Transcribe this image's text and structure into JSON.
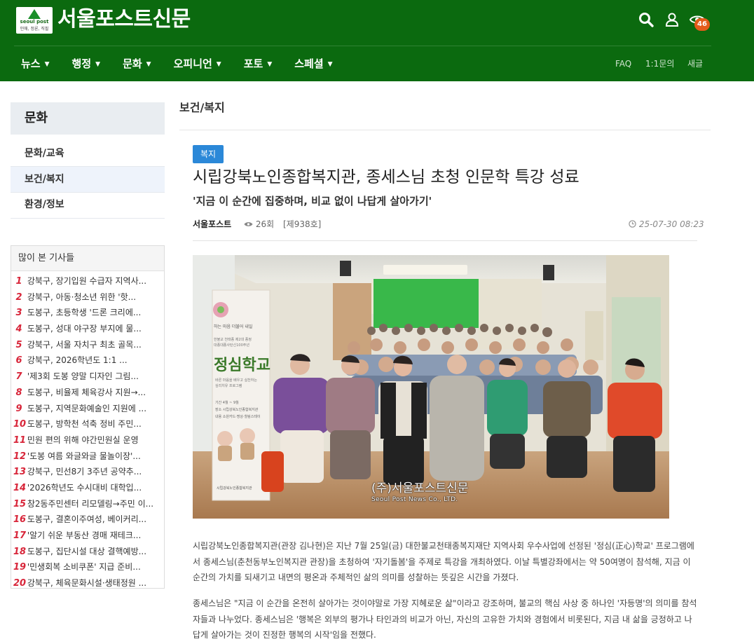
{
  "header": {
    "logo_line1": "seoul post",
    "logo_line2": "인애, 정론, 직필",
    "site_title": "서울포스트신문",
    "notification_count": "46",
    "nav": [
      "뉴스",
      "행정",
      "문화",
      "오피니언",
      "포토",
      "스페셜"
    ],
    "util_links": [
      "FAQ",
      "1:1문의",
      "새글"
    ]
  },
  "sidebar": {
    "heading": "문화",
    "items": [
      "문화/교육",
      "보건/복지",
      "환경/정보"
    ],
    "popular_heading": "많이 본 기사들",
    "popular": [
      {
        "num": "1",
        "title": "강북구, 장기입원 수급자 지역사..."
      },
      {
        "num": "2",
        "title": "강북구, 아동·청소년 위한 '핫..."
      },
      {
        "num": "3",
        "title": "도봉구, 초등학생 '드론 크리에..."
      },
      {
        "num": "4",
        "title": "도봉구, 성대 야구장 부지에 물..."
      },
      {
        "num": "5",
        "title": "강북구, 서울 자치구 최초 골목..."
      },
      {
        "num": "6",
        "title": "강북구, 2026학년도 1:1 ..."
      },
      {
        "num": "7",
        "title": "'제3회 도봉 양말 디자인 그림..."
      },
      {
        "num": "8",
        "title": "도봉구, 비율제 체육강사 지원→..."
      },
      {
        "num": "9",
        "title": "도봉구, 지역문화예술인 지원에 ..."
      },
      {
        "num": "10",
        "title": "도봉구, 방학천 석축 정비 주민..."
      },
      {
        "num": "11",
        "title": "민원 편의 위해 야간민원실 운영"
      },
      {
        "num": "12",
        "title": "'도봉 여름 와글와글 물놀이장'..."
      },
      {
        "num": "13",
        "title": "강북구, 민선8기 3주년 공약추..."
      },
      {
        "num": "14",
        "title": "'2026학년도 수시대비 대학입..."
      },
      {
        "num": "15",
        "title": "창2동주민센터 리모델링→주민 이..."
      },
      {
        "num": "16",
        "title": "도봉구, 결혼이주여성, 베이커리..."
      },
      {
        "num": "17",
        "title": "'알기 쉬운 부동산 경매 재테크..."
      },
      {
        "num": "18",
        "title": "도봉구, 집단시설 대상 결핵예방..."
      },
      {
        "num": "19",
        "title": "'민생회복 소비쿠폰' 지급 준비..."
      },
      {
        "num": "20",
        "title": "강북구, 체육문화시설·생태정원 ..."
      }
    ]
  },
  "article": {
    "breadcrumb": "보건/복지",
    "category": "복지",
    "title": "시립강북노인종합복지관, 종세스님 초청 인문학 특강 성료",
    "subtitle": "'지금 이 순간에 집중하며, 비교 없이 나답게 살아가기'",
    "author": "서울포스트",
    "views": "26회",
    "issue": "[제938호]",
    "date": "25-07-30 08:23",
    "photo_caption1": "(주)서울포스트신문",
    "photo_caption2": "Seoul Post News Co., LTD.",
    "banner_text": {
      "top": "하는 마음 더불어 내일",
      "line2": "한불교 천태종 제2대 종정",
      "line3": "대종대종사탄신100주년",
      "main": "정심학교",
      "desc1": "바른 마음을 배우고 실천하는",
      "desc2": "심리치유 프로그램",
      "row1": "기간 4월 ~ 9월",
      "row2": "장소 시립강북노인종합복지관",
      "row3": "내용 소원카드·명상·힐링스테이",
      "footer": "시립강북노인종합복지관"
    },
    "para1": "시립강북노인종합복지관(관장 김나현)은 지난 7월 25일(금) 대한불교천태종복지재단 지역사회 우수사업에 선정된 '정심(正心)학교' 프로그램에서 종세스님(춘천동부노인복지관 관장)을 초청하여 '자기돌봄'을 주제로 특강을 개최하였다. 이날 특별강좌에서는 약 50여명이 참석해, 지금 이 순간의 가치를 되새기고 내면의 평온과 주체적인 삶의 의미를 성찰하는 뜻깊은 시간을 가졌다.",
    "para2": "종세스님은 \"지금 이 순간을 온전히 살아가는 것이야말로 가장 지혜로운 삶\"이라고 강조하며, 불교의 핵심 사상 중 하나인 '자등명'의 의미를 참석자들과 나누었다. 종세스님은 '행복은 외부의 평가나 타인과의 비교가 아닌, 자신의 고유한 가치와 경험에서 비롯된다, 지금 내 삶을 긍정하고 나답게 살아가는 것이 진정한 행복의 시작'임을 전했다."
  },
  "colors": {
    "header_green": "#0b6a0f",
    "category_blue": "#2b88d8",
    "rank_red": "#d8263a",
    "badge_orange": "#e35b1a"
  }
}
